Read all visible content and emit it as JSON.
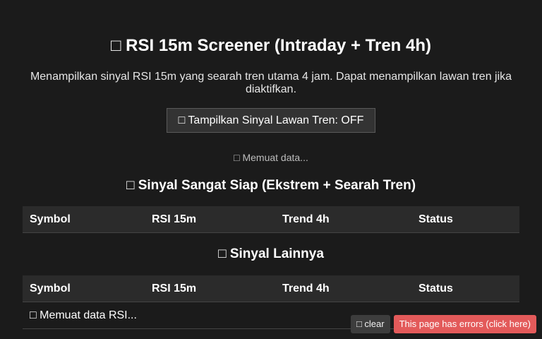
{
  "header": {
    "icon": "chart-icon",
    "title": "□ RSI 15m Screener (Intraday + Tren 4h)",
    "subtitle": "Menampilkan sinyal RSI 15m yang searah tren utama 4 jam. Dapat menampilkan lawan tren jika diaktifkan."
  },
  "toggle": {
    "label": "□ Tampilkan Sinyal Lawan Tren: OFF"
  },
  "status": {
    "loading": "□ Memuat data..."
  },
  "sections": [
    {
      "title": "□ Sinyal Sangat Siap (Ekstrem + Searah Tren)",
      "columns": [
        "Symbol",
        "RSI 15m",
        "Trend 4h",
        "Status"
      ],
      "rows": []
    },
    {
      "title": "□ Sinyal Lainnya",
      "columns": [
        "Symbol",
        "RSI 15m",
        "Trend 4h",
        "Status"
      ],
      "rows": [],
      "loading_row": "□ Memuat data RSI..."
    }
  ],
  "overlay": {
    "clear_label": "□ clear",
    "error_label": "This page has errors (click here)"
  },
  "colors": {
    "background": "#1b1b1b",
    "table_header": "#2b2b2b",
    "error": "#e35a5a"
  }
}
